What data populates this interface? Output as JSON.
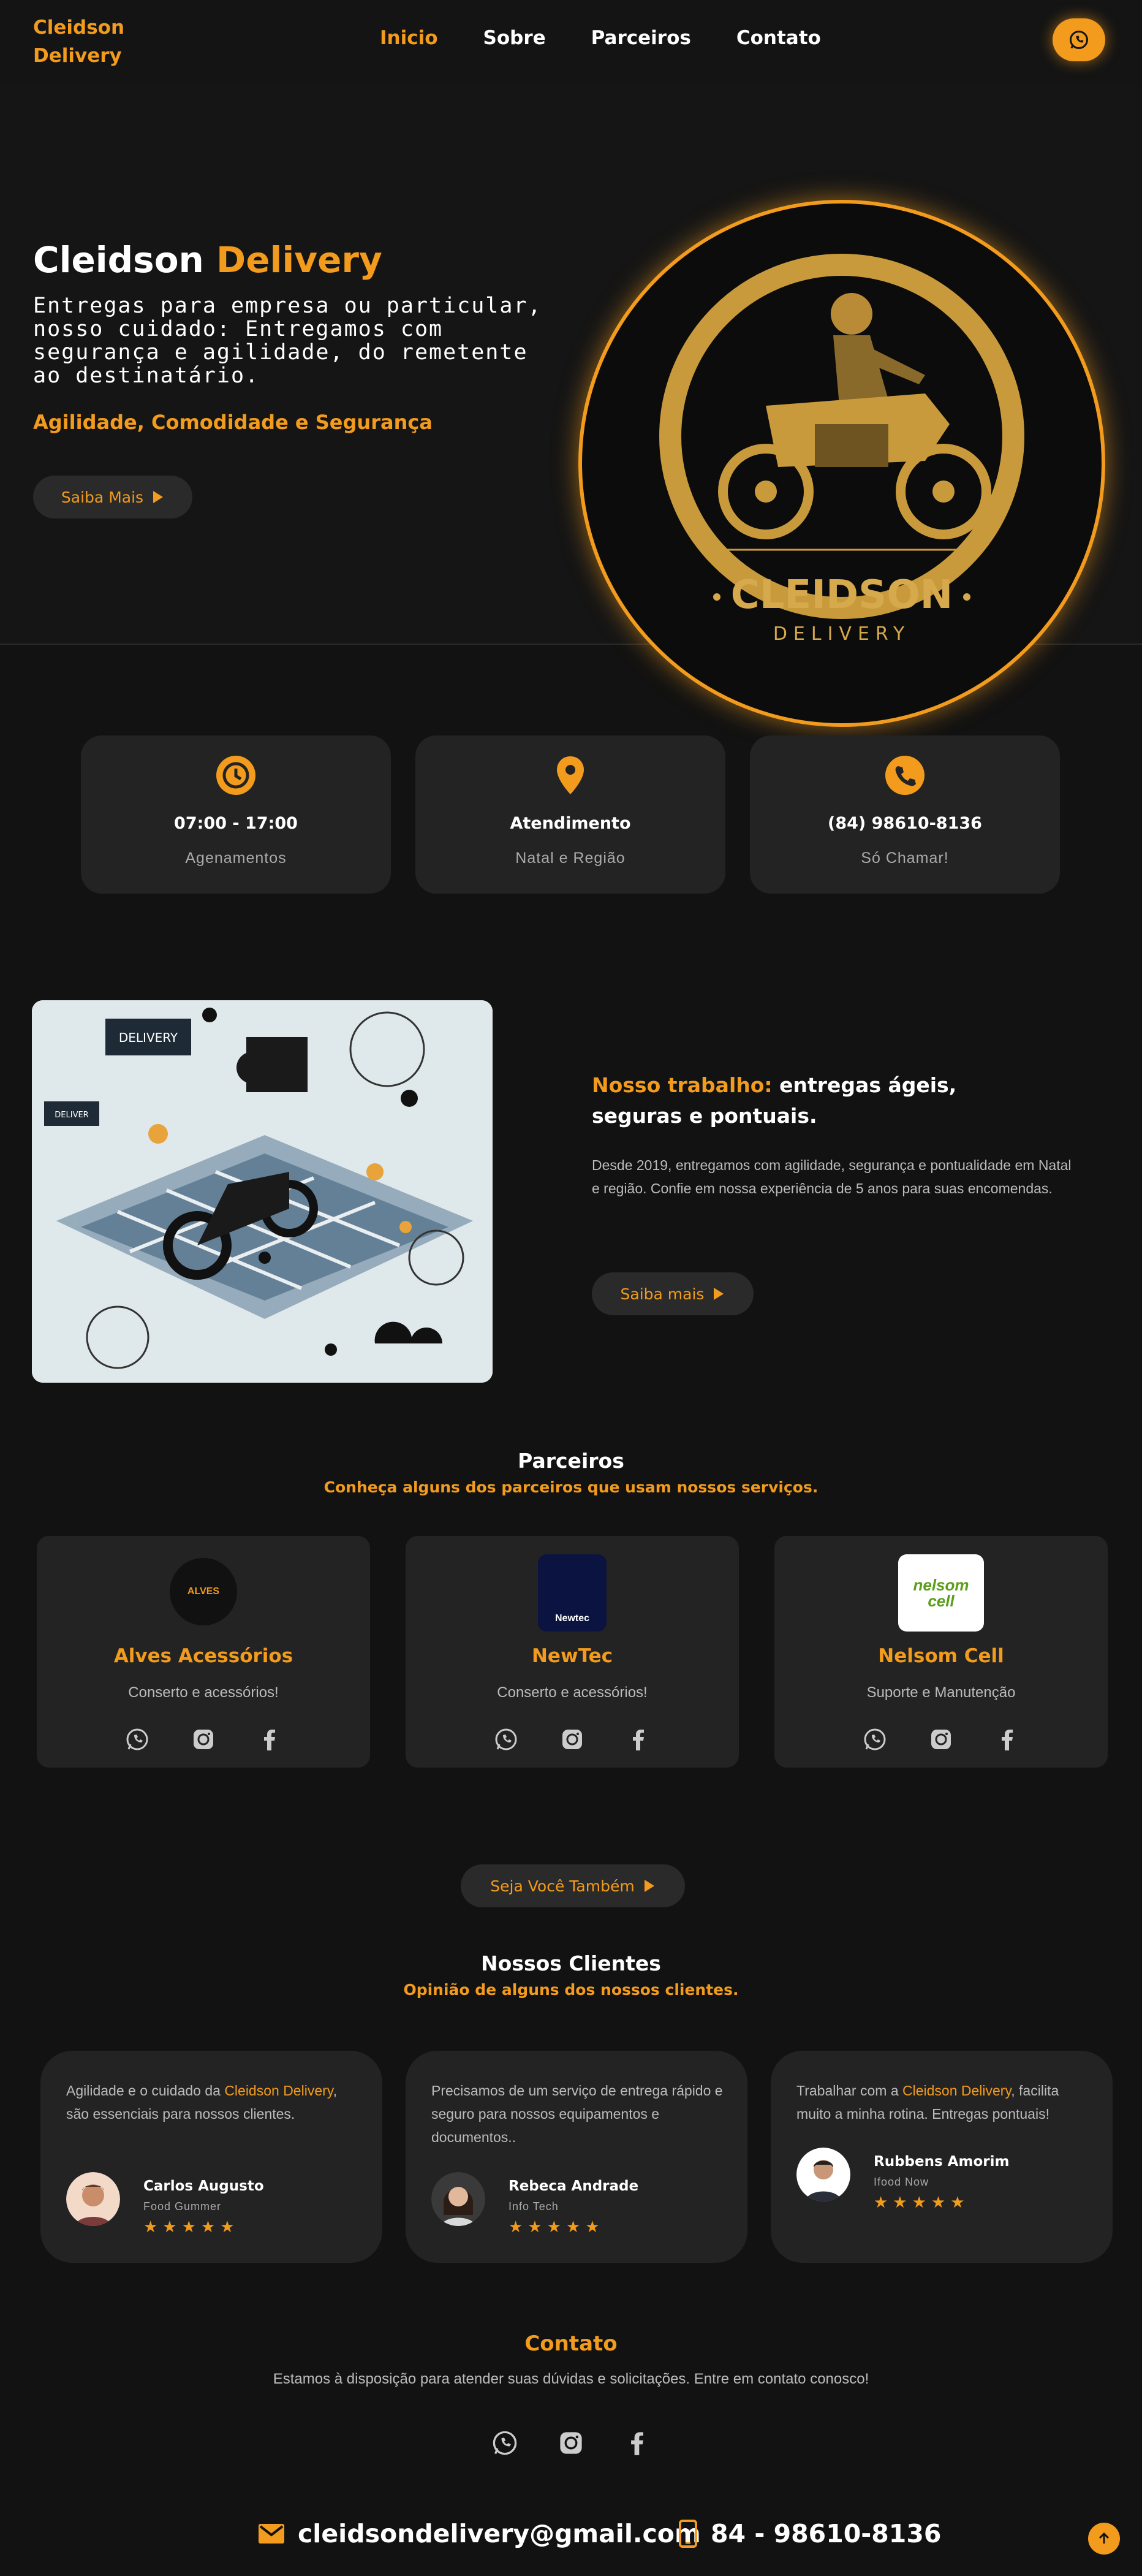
{
  "header": {
    "logo_line1": "Cleidson",
    "logo_line2": "Delivery",
    "nav": [
      "Inicio",
      "Sobre",
      "Parceiros",
      "Contato"
    ]
  },
  "hero": {
    "title_white": "Cleidson",
    "title_orange": "Delivery",
    "description": "Entregas para empresa ou particular, nosso cuidado: Entregamos com segurança e agilidade, do remetente ao destinatário.",
    "slogan": "Agilidade, Comodidade e Segurança",
    "button": "Saiba Mais",
    "emblem_name": "CLEIDSON",
    "emblem_sub": "DELIVERY"
  },
  "info_cards": [
    {
      "icon": "clock-icon",
      "title": "07:00 - 17:00",
      "sub": "Agenamentos"
    },
    {
      "icon": "location-pin-icon",
      "title": "Atendimento",
      "sub": "Natal e Região"
    },
    {
      "icon": "phone-icon",
      "title": "(84) 98610-8136",
      "sub": "Só Chamar!"
    }
  ],
  "about": {
    "title_orange": "Nosso trabalho:",
    "title_white": "entregas ágeis, seguras e pontuais.",
    "text": "Desde 2019, entregamos com agilidade, segurança e pontualidade em Natal e região. Confie em nossa experiência de 5 anos para suas encomendas.",
    "button": "Saiba mais",
    "image_label_1": "DELIVERY",
    "image_label_2": "DELIVER"
  },
  "partners": {
    "title": "Parceiros",
    "subtitle": "Conheça alguns dos parceiros que usam nossos serviços.",
    "items": [
      {
        "name": "Alves Acessórios",
        "sub": "Conserto e acessórios!",
        "logo_text": "ALVES"
      },
      {
        "name": "NewTec",
        "sub": "Conserto e acessórios!",
        "logo_text": "Newtec"
      },
      {
        "name": "Nelsom Cell",
        "sub": "Suporte e Manutenção",
        "logo_text": "nelsom cell"
      }
    ],
    "cta": "Seja Você Também"
  },
  "clients": {
    "title": "Nossos Clientes",
    "subtitle": "Opinião de alguns dos nossos clientes.",
    "items": [
      {
        "text_pre": "Agilidade e o cuidado da ",
        "text_hl": "Cleidson Delivery",
        "text_post": ", são essenciais para nossos clientes.",
        "name": "Carlos Augusto",
        "role": "Food Gummer",
        "stars": "★★★★★"
      },
      {
        "text_pre": "Precisamos de um serviço de entrega rápido e seguro para nossos equipamentos e documentos..",
        "text_hl": "",
        "text_post": "",
        "name": "Rebeca Andrade",
        "role": "Info Tech",
        "stars": "★★★★★"
      },
      {
        "text_pre": "Trabalhar com a ",
        "text_hl": "Cleidson Delivery",
        "text_post": ", facilita muito a minha rotina. Entregas pontuais!",
        "name": "Rubbens Amorim",
        "role": "Ifood Now",
        "stars": "★★★★★"
      }
    ]
  },
  "contact": {
    "title": "Contato",
    "text": "Estamos à disposição para atender suas dúvidas e solicitações. Entre em contato conosco!",
    "email": "cleidsondelivery@gmail.com",
    "phone": "84 - 98610-8136"
  },
  "colors": {
    "accent": "#f29b1d",
    "background": "#121212",
    "card": "#232323"
  }
}
